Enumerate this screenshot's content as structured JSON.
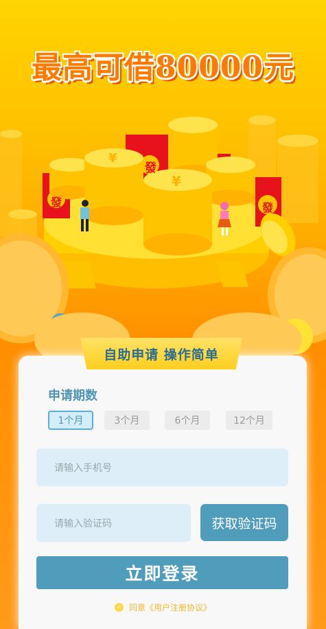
{
  "hero": {
    "headline": "最高可借80000元",
    "badge_char": "發",
    "coin_char": "¥"
  },
  "banner": {
    "text": "自助申请 操作简单"
  },
  "form": {
    "period_title": "申请期数",
    "periods": [
      {
        "label": "1个月",
        "active": true
      },
      {
        "label": "3个月",
        "active": false
      },
      {
        "label": "6个月",
        "active": false
      },
      {
        "label": "12个月",
        "active": false
      }
    ],
    "phone_placeholder": "请输入手机号",
    "code_placeholder": "请输入验证码",
    "get_code_label": "获取验证码",
    "login_label": "立即登录",
    "agree_prefix": "同意",
    "agreement_link": "《用户注册协议》"
  },
  "colors": {
    "accent": "#4f9dba",
    "background_top": "#ffd400",
    "background_bottom": "#ff8f00",
    "headline": "#ff7a00"
  }
}
